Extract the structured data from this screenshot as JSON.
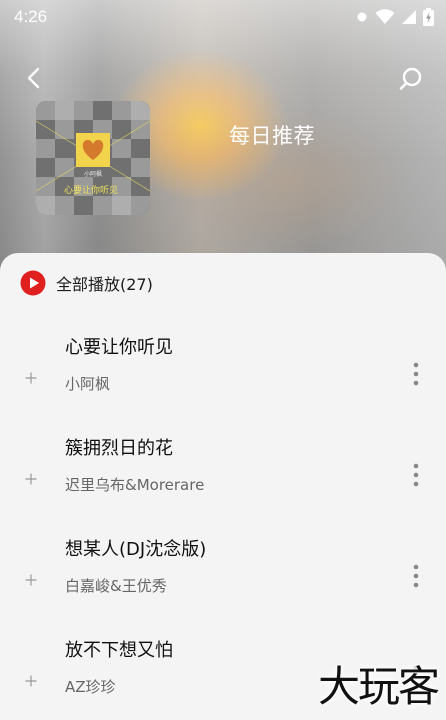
{
  "status_bar": {
    "time": "4:26"
  },
  "header": {
    "title": "每日推荐",
    "back_icon": "chevron-left-icon",
    "search_icon": "search-icon"
  },
  "album": {
    "small_text": "小阿枫",
    "caption": "心要让你听见"
  },
  "play_all": {
    "label": "全部播放(27)",
    "accent": "#e0201f"
  },
  "songs": [
    {
      "title": "心要让你听见",
      "artist": "小阿枫"
    },
    {
      "title": "簇拥烈日的花",
      "artist": "迟里乌布&Morerare"
    },
    {
      "title": "想某人(DJ沈念版)",
      "artist": "白嘉峻&王优秀"
    },
    {
      "title": "放不下想又怕",
      "artist": "AZ珍珍"
    }
  ],
  "watermark": "大玩客"
}
